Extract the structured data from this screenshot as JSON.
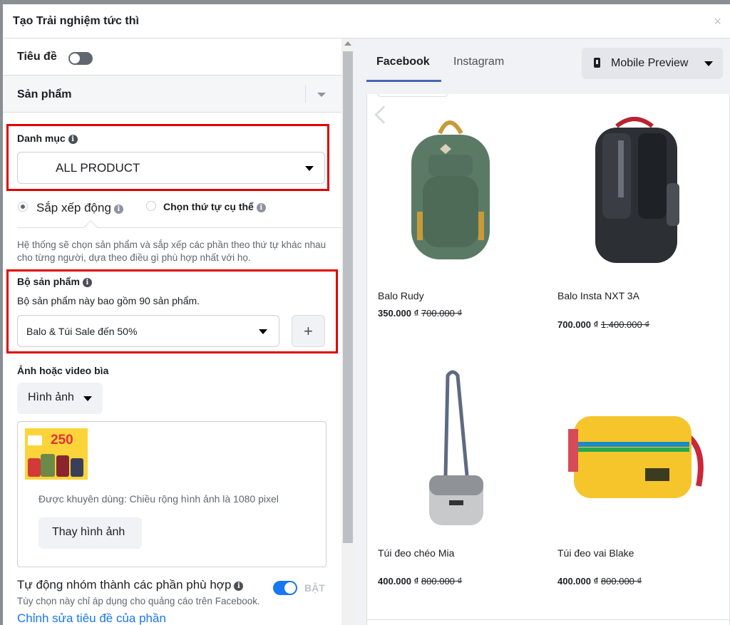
{
  "dialog": {
    "title": "Tạo Trải nghiệm tức thì",
    "close_icon": "×"
  },
  "left": {
    "title_row": {
      "label": "Tiêu đề",
      "toggle_on": false
    },
    "section": {
      "label": "Sản phẩm"
    },
    "category": {
      "label": "Danh mục",
      "value": "ALL PRODUCT"
    },
    "sort": {
      "dynamic_label": "Sắp xếp động",
      "manual_label": "Chọn thứ tự cụ thể",
      "selected": "dynamic",
      "description": "Hệ thống sẽ chọn sản phẩm và sắp xếp các phần theo thứ tự khác nhau cho từng người, dựa theo điều gì phù hợp nhất với họ."
    },
    "product_set": {
      "label": "Bộ sản phẩm",
      "description": "Bộ sản phẩm này bao gồm 90 sản phẩm.",
      "value": "Balo & Túi Sale đến 50%",
      "add_label": "+"
    },
    "cover": {
      "label": "Ảnh hoặc video bìa",
      "type_button": "Hình ảnh",
      "thumbnail_big_text": "250",
      "recommendation": "Được khuyên dùng: Chiều rộng hình ảnh là 1080 pixel",
      "replace_button": "Thay hình ảnh"
    },
    "auto_group": {
      "label": "Tự động nhóm thành các phần phù hợp",
      "toggle_on": true,
      "toggle_label": "BẬT",
      "note": "Tùy chọn này chỉ áp dụng cho quảng cáo trên Facebook.",
      "link": "Chỉnh sửa tiêu đề của phần"
    }
  },
  "right": {
    "tabs": [
      {
        "label": "Facebook",
        "active": true
      },
      {
        "label": "Instagram",
        "active": false
      }
    ],
    "preview_button": "Mobile Preview",
    "products": [
      {
        "name": "Balo Rudy",
        "price": "350.000 ₫",
        "old_price": "700.000 ₫",
        "image": "green-backpack"
      },
      {
        "name": "Balo Insta NXT 3A",
        "price": "700.000 ₫",
        "old_price": "1.400.000 ₫",
        "image": "black-backpack"
      },
      {
        "name": "Túi đeo chéo Mia",
        "price": "400.000 ₫",
        "old_price": "800.000 ₫",
        "image": "crossbody-bag"
      },
      {
        "name": "Túi đeo vai Blake",
        "price": "400.000 ₫",
        "old_price": "800.000 ₫",
        "image": "yellow-shoulder-bag"
      }
    ]
  },
  "colors": {
    "highlight_box": "#e00000",
    "facebook_blue": "#1877f2",
    "tab_underline": "#4267b2"
  }
}
